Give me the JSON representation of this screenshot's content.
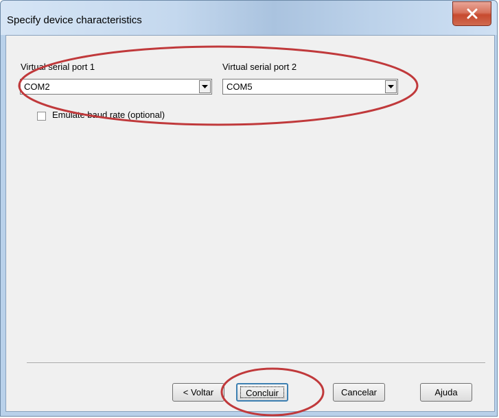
{
  "dialog": {
    "title": "Specify device characteristics",
    "close_label": "x"
  },
  "ports": {
    "port1_label": "Virtual serial port 1",
    "port1_value": "COM2",
    "port2_label": "Virtual serial port 2",
    "port2_value": "COM5"
  },
  "options": {
    "emulate_baud_label": "Emulate baud rate (optional)",
    "emulate_baud_checked": false
  },
  "buttons": {
    "back": "< Voltar",
    "finish": "Concluir",
    "cancel": "Cancelar",
    "help": "Ajuda"
  },
  "annotations": {
    "color": "#c0393b"
  }
}
